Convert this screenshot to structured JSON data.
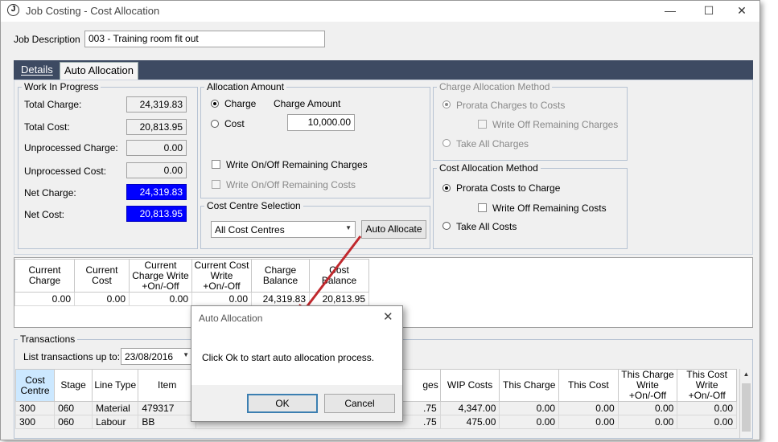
{
  "window": {
    "title": "Job Costing - Cost Allocation",
    "minimize": "—",
    "maximize": "☐",
    "close": "✕"
  },
  "job": {
    "label": "Job Description",
    "value": "003 - Training room fit out"
  },
  "tabs": [
    {
      "label": "Details",
      "active": false
    },
    {
      "label": "Auto Allocation",
      "active": true
    }
  ],
  "wip": {
    "legend": "Work In Progress",
    "rows": [
      {
        "label": "Total Charge:",
        "value": "24,319.83",
        "highlight": false
      },
      {
        "label": "Total Cost:",
        "value": "20,813.95",
        "highlight": false
      },
      {
        "label": "Unprocessed Charge:",
        "value": "0.00",
        "highlight": false
      },
      {
        "label": "Unprocessed Cost:",
        "value": "0.00",
        "highlight": false
      },
      {
        "label": "Net Charge:",
        "value": "24,319.83",
        "highlight": true
      },
      {
        "label": "Net Cost:",
        "value": "20,813.95",
        "highlight": true
      }
    ]
  },
  "allocation": {
    "legend": "Allocation Amount",
    "charge_label": "Charge",
    "cost_label": "Cost",
    "charge_amount_label": "Charge Amount",
    "charge_amount_value": "10,000.00",
    "write_charges": "Write On/Off Remaining Charges",
    "write_costs": "Write On/Off Remaining Costs"
  },
  "cost_centre": {
    "legend": "Cost Centre Selection",
    "selected": "All Cost Centres",
    "button": "Auto Allocate"
  },
  "charge_method": {
    "legend": "Charge Allocation Method",
    "prorata": "Prorata Charges to Costs",
    "write_off": "Write Off Remaining Charges",
    "take_all": "Take All Charges"
  },
  "cost_method": {
    "legend": "Cost Allocation Method",
    "prorata": "Prorata Costs to Charge",
    "write_off": "Write Off Remaining Costs",
    "take_all": "Take All Costs"
  },
  "summary_grid": {
    "headers": [
      [
        "Current",
        "Charge"
      ],
      [
        "Current Cost"
      ],
      [
        "Current",
        "Charge Write",
        "+On/-Off"
      ],
      [
        "Current Cost",
        "Write",
        "+On/-Off"
      ],
      [
        "Charge",
        "Balance"
      ],
      [
        "Cost Balance"
      ]
    ],
    "row": [
      "0.00",
      "0.00",
      "0.00",
      "0.00",
      "24,319.83",
      "20,813.95"
    ]
  },
  "transactions": {
    "legend": "Transactions",
    "list_label": "List transactions up to:",
    "date": "23/08/2016",
    "headers": [
      [
        "Cost",
        "Centre"
      ],
      [
        "Stage"
      ],
      [
        "Line Type"
      ],
      [
        "Item"
      ],
      [
        "ges"
      ],
      [
        "WIP Costs"
      ],
      [
        "This Charge"
      ],
      [
        "This Cost"
      ],
      [
        "This Charge",
        "Write",
        "+On/-Off"
      ],
      [
        "This Cost",
        "Write",
        "+On/-Off"
      ]
    ],
    "rows": [
      [
        "300",
        "060",
        "Material",
        "479317",
        ".75",
        "4,347.00",
        "0.00",
        "0.00",
        "0.00",
        "0.00"
      ],
      [
        "300",
        "060",
        "Labour",
        "BB",
        ".75",
        "475.00",
        "0.00",
        "0.00",
        "0.00",
        "0.00"
      ]
    ]
  },
  "dialog": {
    "title": "Auto Allocation",
    "message": "Click Ok to start auto allocation process.",
    "ok": "OK",
    "cancel": "Cancel",
    "close": "✕"
  },
  "colors": {
    "tabstrip": "#3d4a62",
    "highlight_field": "#0000ff",
    "arrow": "#c0282d"
  }
}
